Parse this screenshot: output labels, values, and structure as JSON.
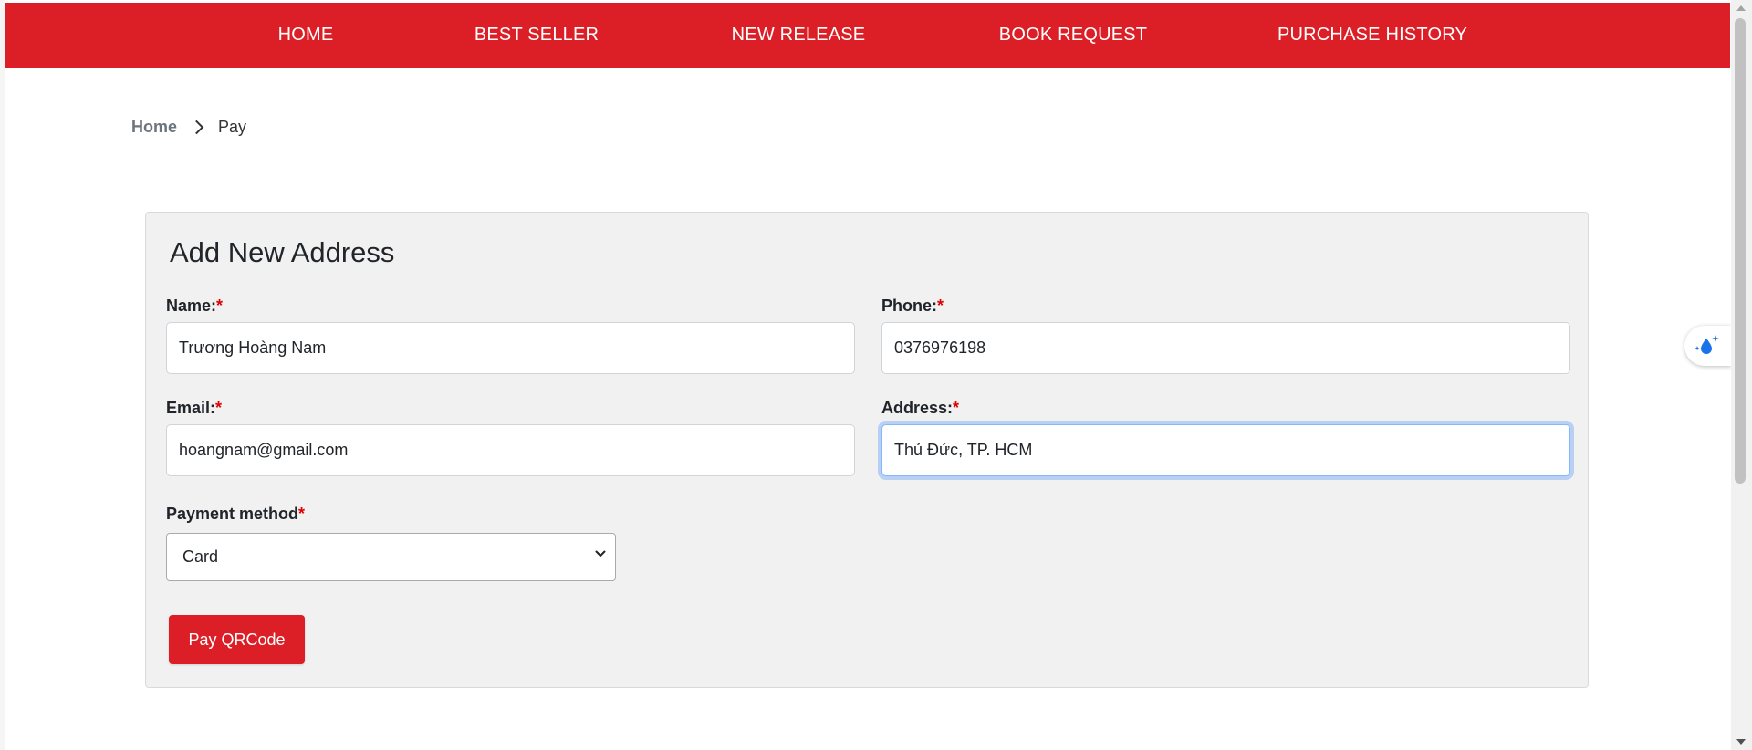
{
  "nav": {
    "items": [
      {
        "label": "HOME"
      },
      {
        "label": "BEST SELLER"
      },
      {
        "label": "NEW RELEASE"
      },
      {
        "label": "BOOK REQUEST"
      },
      {
        "label": "PURCHASE HISTORY"
      }
    ]
  },
  "breadcrumb": {
    "home": "Home",
    "current": "Pay"
  },
  "form": {
    "title": "Add New Address",
    "required_mark": "*",
    "name": {
      "label": "Name:",
      "value": "Trương Hoàng Nam"
    },
    "phone": {
      "label": "Phone:",
      "value": "0376976198"
    },
    "email": {
      "label": "Email:",
      "value": "hoangnam@gmail.com"
    },
    "address": {
      "label": "Address:",
      "value": "Thủ Đức, TP. HCM"
    },
    "payment": {
      "label": "Payment method",
      "selected": "Card"
    },
    "submit_label": "Pay QRCode"
  },
  "colors": {
    "brand_red": "#dc1f26",
    "panel_bg": "#f1f1f1",
    "focus_ring": "#86b7fe"
  },
  "icons": {
    "breadcrumb_separator": "chevron-right-icon",
    "select_arrow": "chevron-down-icon",
    "floating_widget": "water-drop-sparkle-icon"
  }
}
